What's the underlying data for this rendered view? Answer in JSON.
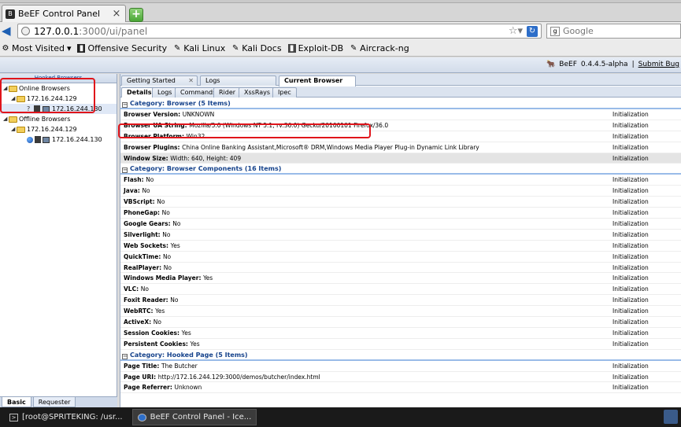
{
  "browser": {
    "tab_title": "BeEF Control Panel",
    "url_host": "127.0.0.1",
    "url_rest": ":3000/ui/panel",
    "search_placeholder": "Google",
    "bookmarks": [
      {
        "label": "Most Visited",
        "icon": "gear-icon"
      },
      {
        "label": "Offensive Security",
        "icon": "offsec-icon"
      },
      {
        "label": "Kali Linux",
        "icon": "kali-icon"
      },
      {
        "label": "Kali Docs",
        "icon": "kali-icon"
      },
      {
        "label": "Exploit-DB",
        "icon": "exploitdb-icon"
      },
      {
        "label": "Aircrack-ng",
        "icon": "kali-icon"
      }
    ]
  },
  "header": {
    "app_name": "BeEF",
    "version": "0.4.4.5-alpha",
    "separator": "|",
    "submit_bug": "Submit Bug"
  },
  "left": {
    "title": "Hooked Browsers",
    "online_label": "Online Browsers",
    "offline_label": "Offline Browsers",
    "online_subnet": "172.16.244.129",
    "online_host": "172.16.244.130",
    "offline_subnet": "172.16.244.129",
    "offline_host": "172.16.244.130",
    "unknown_mark": "?",
    "tabs": [
      "Basic",
      "Requester"
    ]
  },
  "tabs_main": [
    "Getting Started",
    "Logs",
    "Current Browser"
  ],
  "tabs_sub": [
    "Details",
    "Logs",
    "Commands",
    "Rider",
    "XssRays",
    "Ipec"
  ],
  "categories": [
    {
      "title": "Category: Browser (5 Items)",
      "rows": [
        {
          "key": "Browser Version",
          "value": "UNKNOWN",
          "init": "Initialization"
        },
        {
          "key": "Browser UA String",
          "value": "Mozilla/5.0 (Windows NT 5.1; rv:36.0) Gecko/20100101 Firefox/36.0",
          "init": "Initialization"
        },
        {
          "key": "Browser Platform",
          "value": "Win32",
          "init": "Initialization"
        },
        {
          "key": "Browser Plugins",
          "value": "China Online Banking Assistant,Microsoft® DRM,Windows Media Player Plug-in Dynamic Link Library",
          "init": "Initialization"
        },
        {
          "key": "Window Size",
          "value": "Width: 640, Height: 409",
          "init": "Initialization"
        }
      ]
    },
    {
      "title": "Category: Browser Components (16 Items)",
      "rows": [
        {
          "key": "Flash",
          "value": "No",
          "init": "Initialization"
        },
        {
          "key": "Java",
          "value": "No",
          "init": "Initialization"
        },
        {
          "key": "VBScript",
          "value": "No",
          "init": "Initialization"
        },
        {
          "key": "PhoneGap",
          "value": "No",
          "init": "Initialization"
        },
        {
          "key": "Google Gears",
          "value": "No",
          "init": "Initialization"
        },
        {
          "key": "Silverlight",
          "value": "No",
          "init": "Initialization"
        },
        {
          "key": "Web Sockets",
          "value": "Yes",
          "init": "Initialization"
        },
        {
          "key": "QuickTime",
          "value": "No",
          "init": "Initialization"
        },
        {
          "key": "RealPlayer",
          "value": "No",
          "init": "Initialization"
        },
        {
          "key": "Windows Media Player",
          "value": "Yes",
          "init": "Initialization"
        },
        {
          "key": "VLC",
          "value": "No",
          "init": "Initialization"
        },
        {
          "key": "Foxit Reader",
          "value": "No",
          "init": "Initialization"
        },
        {
          "key": "WebRTC",
          "value": "Yes",
          "init": "Initialization"
        },
        {
          "key": "ActiveX",
          "value": "No",
          "init": "Initialization"
        },
        {
          "key": "Session Cookies",
          "value": "Yes",
          "init": "Initialization"
        },
        {
          "key": "Persistent Cookies",
          "value": "Yes",
          "init": "Initialization"
        }
      ]
    },
    {
      "title": "Category: Hooked Page (5 Items)",
      "rows": [
        {
          "key": "Page Title",
          "value": "The Butcher",
          "init": "Initialization"
        },
        {
          "key": "Page URI",
          "value": "http://172.16.244.129:3000/demos/butcher/index.html",
          "init": "Initialization"
        },
        {
          "key": "Page Referrer",
          "value": "Unknown",
          "init": "Initialization"
        }
      ]
    }
  ],
  "taskbar": [
    {
      "label": "[root@SPRITEKING: /usr...",
      "active": false
    },
    {
      "label": "BeEF Control Panel - Ice...",
      "active": true
    }
  ],
  "colors": {
    "highlight_box": "#e0151b",
    "category_text": "#15428b"
  }
}
